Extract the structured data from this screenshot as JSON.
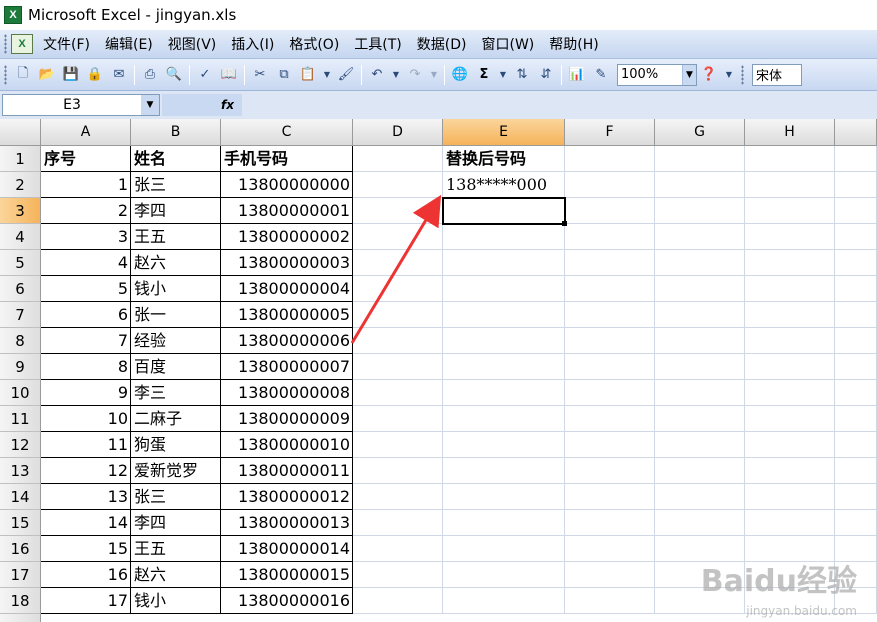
{
  "window": {
    "title": "Microsoft Excel - jingyan.xls",
    "app_icon_glyph": "X"
  },
  "menu": {
    "items": [
      "文件(F)",
      "编辑(E)",
      "视图(V)",
      "插入(I)",
      "格式(O)",
      "工具(T)",
      "数据(D)",
      "窗口(W)",
      "帮助(H)"
    ]
  },
  "toolbar": {
    "zoom": "100%",
    "font": "宋体",
    "sigma": "Σ"
  },
  "formula_bar": {
    "name_box": "E3",
    "fx": "fx"
  },
  "grid": {
    "columns": [
      "A",
      "B",
      "C",
      "D",
      "E",
      "F",
      "G",
      "H"
    ],
    "selected_column": "E",
    "selected_row": "3",
    "header_row": {
      "A": "序号",
      "B": "姓名",
      "C": "手机号码",
      "E": "替换后号码"
    },
    "rows": [
      {
        "n": "2",
        "a": "1",
        "b": "张三",
        "c": "13800000000",
        "e": "138*****000"
      },
      {
        "n": "3",
        "a": "2",
        "b": "李四",
        "c": "13800000001",
        "e": ""
      },
      {
        "n": "4",
        "a": "3",
        "b": "王五",
        "c": "13800000002",
        "e": ""
      },
      {
        "n": "5",
        "a": "4",
        "b": "赵六",
        "c": "13800000003",
        "e": ""
      },
      {
        "n": "6",
        "a": "5",
        "b": "钱小",
        "c": "13800000004",
        "e": ""
      },
      {
        "n": "7",
        "a": "6",
        "b": "张一",
        "c": "13800000005",
        "e": ""
      },
      {
        "n": "8",
        "a": "7",
        "b": "经验",
        "c": "13800000006",
        "e": ""
      },
      {
        "n": "9",
        "a": "8",
        "b": "百度",
        "c": "13800000007",
        "e": ""
      },
      {
        "n": "10",
        "a": "9",
        "b": "李三",
        "c": "13800000008",
        "e": ""
      },
      {
        "n": "11",
        "a": "10",
        "b": "二麻子",
        "c": "13800000009",
        "e": ""
      },
      {
        "n": "12",
        "a": "11",
        "b": "狗蛋",
        "c": "13800000010",
        "e": ""
      },
      {
        "n": "13",
        "a": "12",
        "b": "爱新觉罗",
        "c": "13800000011",
        "e": ""
      },
      {
        "n": "14",
        "a": "13",
        "b": "张三",
        "c": "13800000012",
        "e": ""
      },
      {
        "n": "15",
        "a": "14",
        "b": "李四",
        "c": "13800000013",
        "e": ""
      },
      {
        "n": "16",
        "a": "15",
        "b": "王五",
        "c": "13800000014",
        "e": ""
      },
      {
        "n": "17",
        "a": "16",
        "b": "赵六",
        "c": "13800000015",
        "e": ""
      },
      {
        "n": "18",
        "a": "17",
        "b": "钱小",
        "c": "13800000016",
        "e": ""
      }
    ]
  },
  "annotation": {
    "arrow_color": "#ee3333"
  },
  "watermark": {
    "text": "Baidu经验",
    "sub": "jingyan.baidu.com"
  }
}
